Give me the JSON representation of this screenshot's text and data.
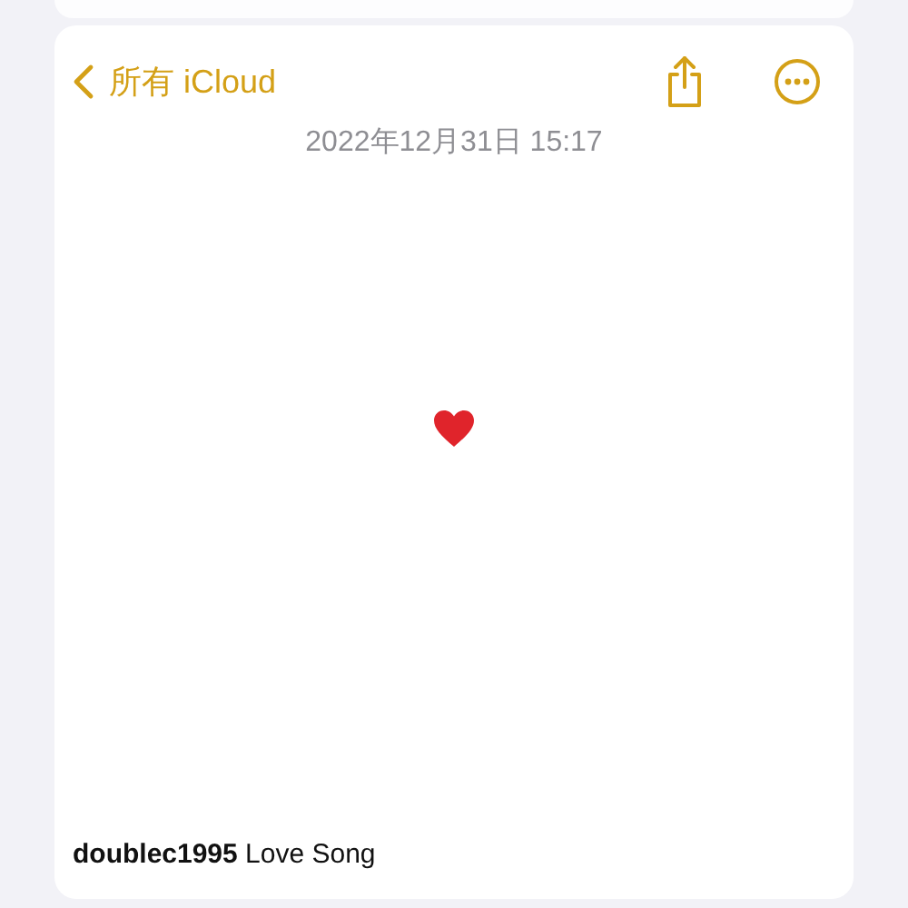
{
  "nav": {
    "back_label": "所有 iCloud"
  },
  "note": {
    "date": "2022年12月31日 15:17"
  },
  "caption": "**doublec1995** Love Song"
}
